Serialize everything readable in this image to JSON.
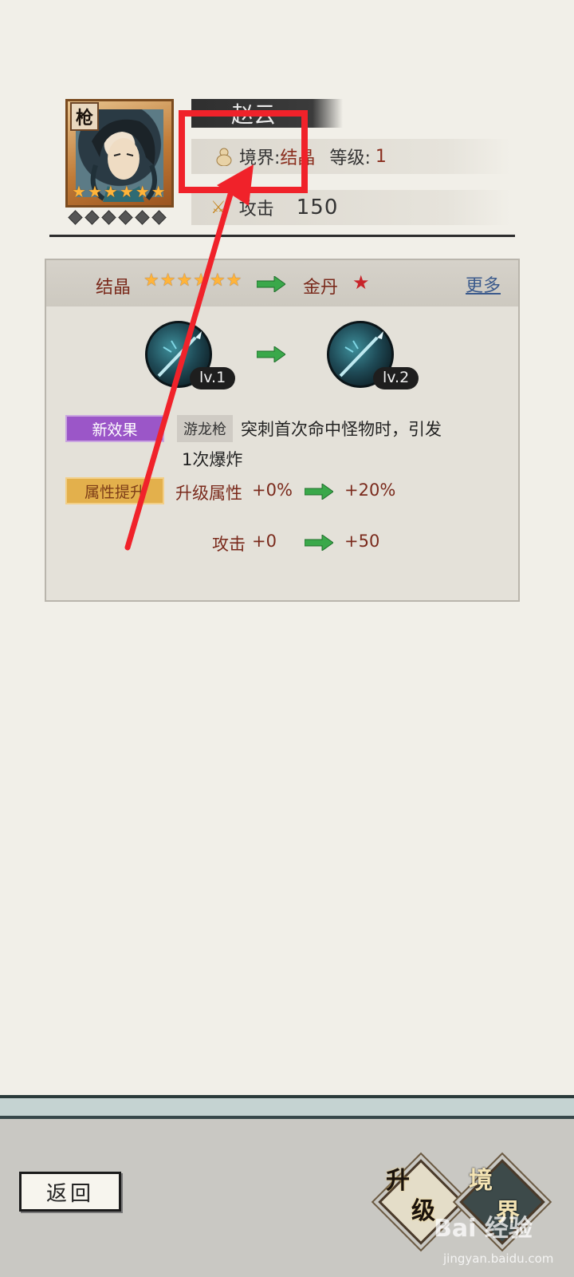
{
  "hero": {
    "weapon_type": "枪",
    "name": "赵云",
    "star_count": 6,
    "awaken_count": 6,
    "realm_label": "境界:",
    "realm_value": "结晶",
    "level_label": "等级:",
    "level_value": "1",
    "attack_label": "攻击",
    "attack_value": "150"
  },
  "upgrade": {
    "from_stage": "结晶",
    "from_stars": 6,
    "to_stage": "金丹",
    "to_stars": 1,
    "more_label": "更多",
    "skill_from_level": "lv.1",
    "skill_to_level": "lv.2",
    "new_effect_tag": "新效果",
    "skill_name": "游龙枪",
    "effect_text_line1": "突刺首次命中怪物时，引发",
    "effect_text_line2": "1次爆炸",
    "attr_tag": "属性提升",
    "stat1_label": "升级属性",
    "stat1_from": "+0%",
    "stat1_to": "+20%",
    "stat2_label": "攻击",
    "stat2_from": "+0",
    "stat2_to": "+50"
  },
  "bottom": {
    "back_label": "返回",
    "upgrade_btn_1": "升",
    "upgrade_btn_2": "级",
    "realm_btn_1": "境",
    "realm_btn_2": "界"
  },
  "watermark": {
    "brand": "Bai 经验",
    "url": "jingyan.baidu.com"
  },
  "colors": {
    "annotation_red": "#f0222a",
    "star_gold": "#ffb43a",
    "arrow_green": "#3aa84a",
    "new_effect_purple": "#9b56c8",
    "attr_gold": "#e3b04c"
  }
}
